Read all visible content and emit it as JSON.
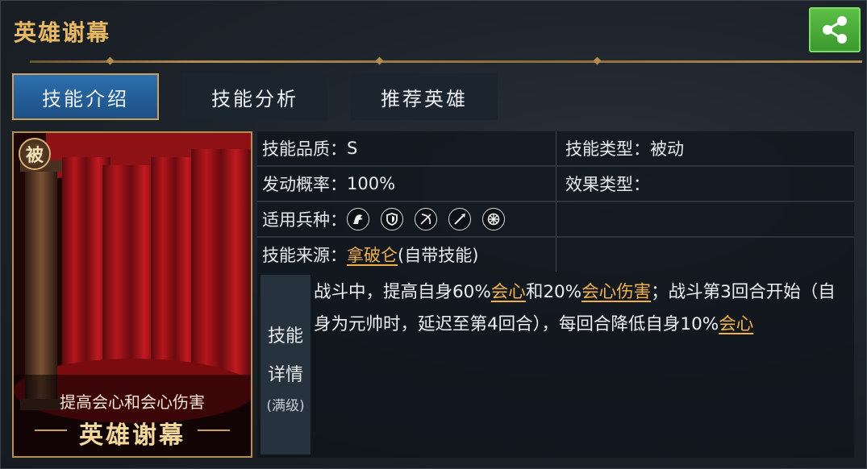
{
  "header": {
    "title": "英雄谢幕"
  },
  "tabs": [
    {
      "label": "技能介绍"
    },
    {
      "label": "技能分析"
    },
    {
      "label": "推荐英雄"
    }
  ],
  "card": {
    "badge": "被",
    "description": "提高会心和会心伤害",
    "name": "英雄谢幕"
  },
  "info": {
    "quality_label": "技能品质：",
    "quality_value": "S",
    "type_label": "技能类型：",
    "type_value": "被动",
    "trigger_label": "发动概率：",
    "trigger_value": "100%",
    "effect_label": "效果类型：",
    "effect_value": "",
    "troops_label": "适用兵种：",
    "troop_icons": [
      "cavalry-icon",
      "shield-icon",
      "archer-icon",
      "spear-icon",
      "siege-icon"
    ],
    "source_label": "技能来源：",
    "source_hero": "拿破仑",
    "source_suffix": "(自带技能)"
  },
  "detail": {
    "label_line1": "技能",
    "label_line2": "详情",
    "label_line3": "(满级)",
    "t1": "战斗中，提高自身60%",
    "k1": "会心",
    "t2": "和20%",
    "k2": "会心伤害",
    "t3": "；战斗第3回合开始（自身为元帅时，延迟至第4回合），每回合降低自身10%",
    "k3": "会心"
  },
  "colors": {
    "accent_gold": "#e8b862",
    "link_orange": "#f0b04a",
    "tab_active_blue": "#2c6fae",
    "share_green": "#4cae3a"
  }
}
